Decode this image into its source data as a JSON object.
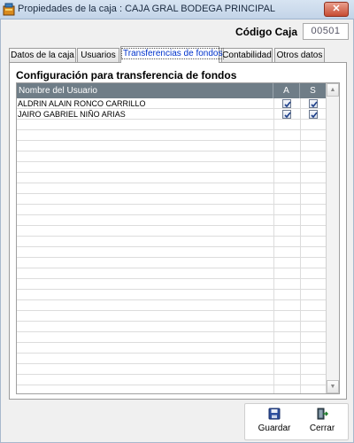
{
  "window": {
    "title": "Propiedades de la caja : CAJA GRAL BODEGA PRINCIPAL",
    "close_label": "✕"
  },
  "header": {
    "code_label": "Código Caja",
    "code_value": "00501"
  },
  "tabs": [
    {
      "label": "Datos de la caja",
      "active": false
    },
    {
      "label": "Usuarios",
      "active": false
    },
    {
      "label": "Transferencias de fondos",
      "active": true
    },
    {
      "label": "Contabilidad",
      "active": false
    },
    {
      "label": "Otros datos",
      "active": false
    }
  ],
  "panel": {
    "section_title": "Configuración para transferencia de fondos",
    "columns": {
      "name": "Nombre del Usuario",
      "a": "A",
      "s": "S"
    },
    "rows": [
      {
        "name": "ALDRIN ALAIN RONCO CARRILLO",
        "a": true,
        "s": true
      },
      {
        "name": "JAIRO GABRIEL NIÑO ARIAS",
        "a": true,
        "s": true
      }
    ]
  },
  "actions": {
    "save_label": "Guardar",
    "close_label": "Cerrar"
  },
  "colors": {
    "grid_header": "#6f7d87",
    "active_tab_text": "#0033cc",
    "close_button": "#c74c32"
  }
}
